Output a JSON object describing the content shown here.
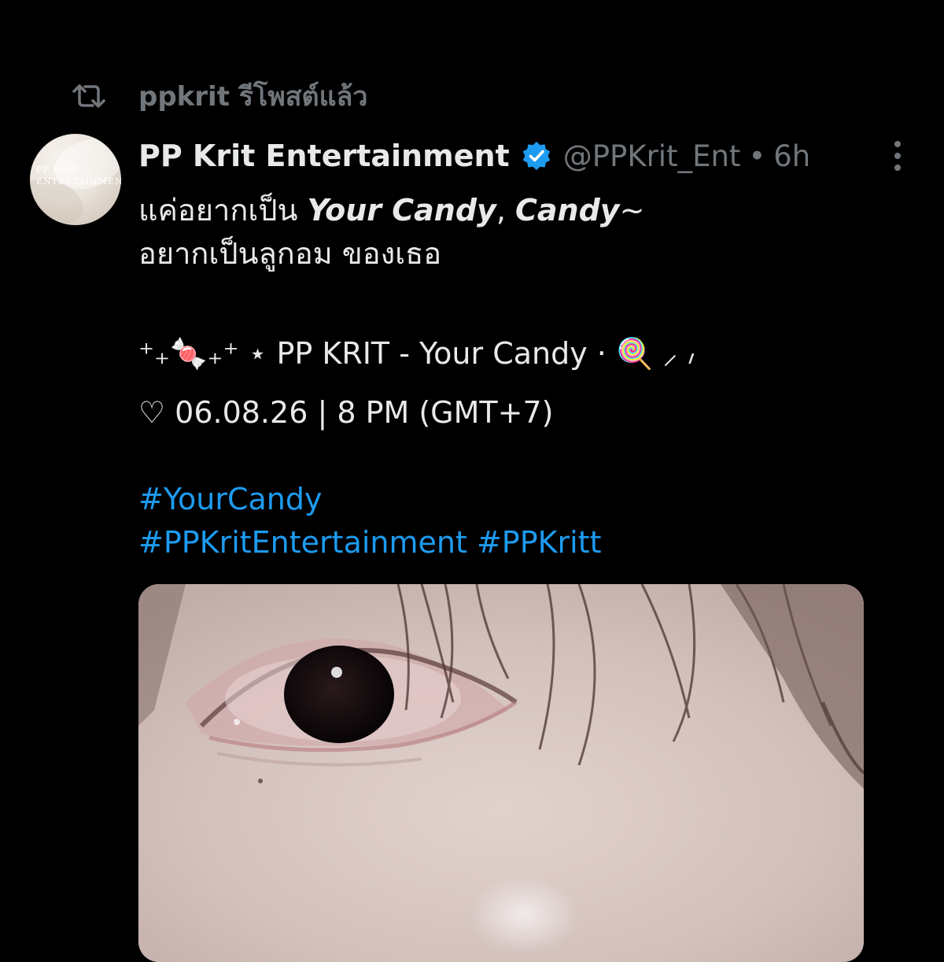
{
  "repost": {
    "icon": "repost-icon",
    "text": "ppkrit รีโพสต์แล้ว"
  },
  "author": {
    "avatar_text_line1": "PP KRIT",
    "avatar_text_line2": "ENTERTAINMENT",
    "display_name": "PP Krit Entertainment",
    "verified_icon": "verified-badge-icon",
    "handle": "@PPKrit_Ent",
    "separator": "•",
    "time": "6h"
  },
  "post": {
    "line1_prefix": "แค่อยากเป็น ",
    "line1_em1": "Your Candy",
    "line1_comma": ", ",
    "line1_em2": "Candy",
    "line1_suffix": "~",
    "line2": "อยากเป็นลูกอม ของเธอ",
    "line3": "⁺₊🍬₊⁺ ⋆ PP KRIT - Your Candy · 🍭 ⸝ ៸",
    "line4": "♡ 06.08.26 | 8 PM (GMT+7)",
    "hashtag1": "#YourCandy",
    "hashtag2": "#PPKritEntertainment",
    "hashtag3": "#PPKritt"
  },
  "media": {
    "alt": "close-up photo of an eye with hair strands"
  },
  "colors": {
    "background": "#000000",
    "text": "#e7e9ea",
    "muted": "#71767b",
    "link": "#1d9bf0",
    "verified": "#1d9bf0"
  }
}
